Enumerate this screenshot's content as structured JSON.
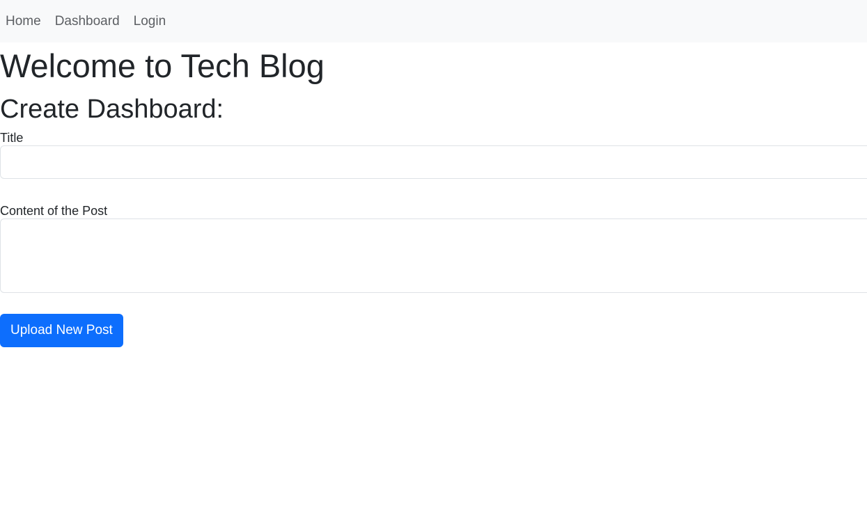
{
  "nav": {
    "items": [
      {
        "label": "Home"
      },
      {
        "label": "Dashboard"
      },
      {
        "label": "Login"
      }
    ]
  },
  "header": {
    "title": "Welcome to Tech Blog"
  },
  "form": {
    "heading": "Create Dashboard:",
    "title_label": "Title",
    "title_value": "",
    "content_label": "Content of the Post",
    "content_value": "",
    "submit_label": "Upload New Post"
  },
  "colors": {
    "accent": "#0d6efd",
    "navbar_bg": "#f8f9fa"
  }
}
